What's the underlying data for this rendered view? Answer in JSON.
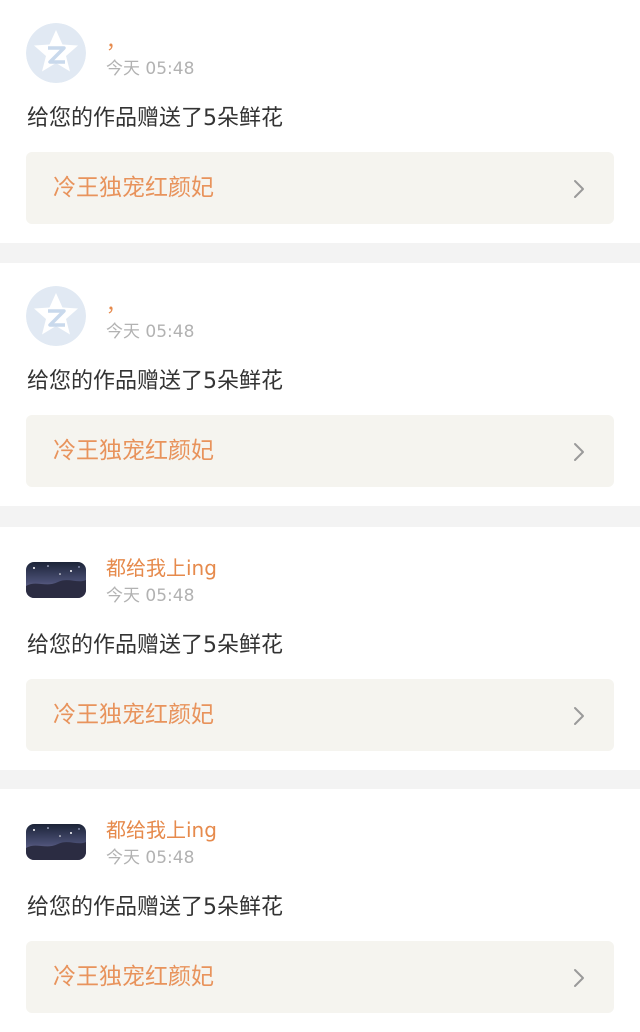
{
  "feed": {
    "items": [
      {
        "avatar": "default-avatar",
        "username": "，",
        "time": "今天 05:48",
        "message": "给您的作品赠送了5朵鲜花",
        "work_title": "冷王独宠红颜妃"
      },
      {
        "avatar": "default-avatar",
        "username": "，",
        "time": "今天 05:48",
        "message": "给您的作品赠送了5朵鲜花",
        "work_title": "冷王独宠红颜妃"
      },
      {
        "avatar": "photo-avatar",
        "username": "都给我上ing",
        "time": "今天 05:48",
        "message": "给您的作品赠送了5朵鲜花",
        "work_title": "冷王独宠红颜妃"
      },
      {
        "avatar": "photo-avatar",
        "username": "都给我上ing",
        "time": "今天 05:48",
        "message": "给您的作品赠送了5朵鲜花",
        "work_title": "冷王独宠红颜妃"
      }
    ]
  },
  "colors": {
    "username": "#e68a4c",
    "work_title": "#e8935c",
    "timestamp": "#b2b2b2",
    "message": "#333333",
    "work_link_background": "#f5f4ef",
    "page_background": "#f3f3f3"
  }
}
